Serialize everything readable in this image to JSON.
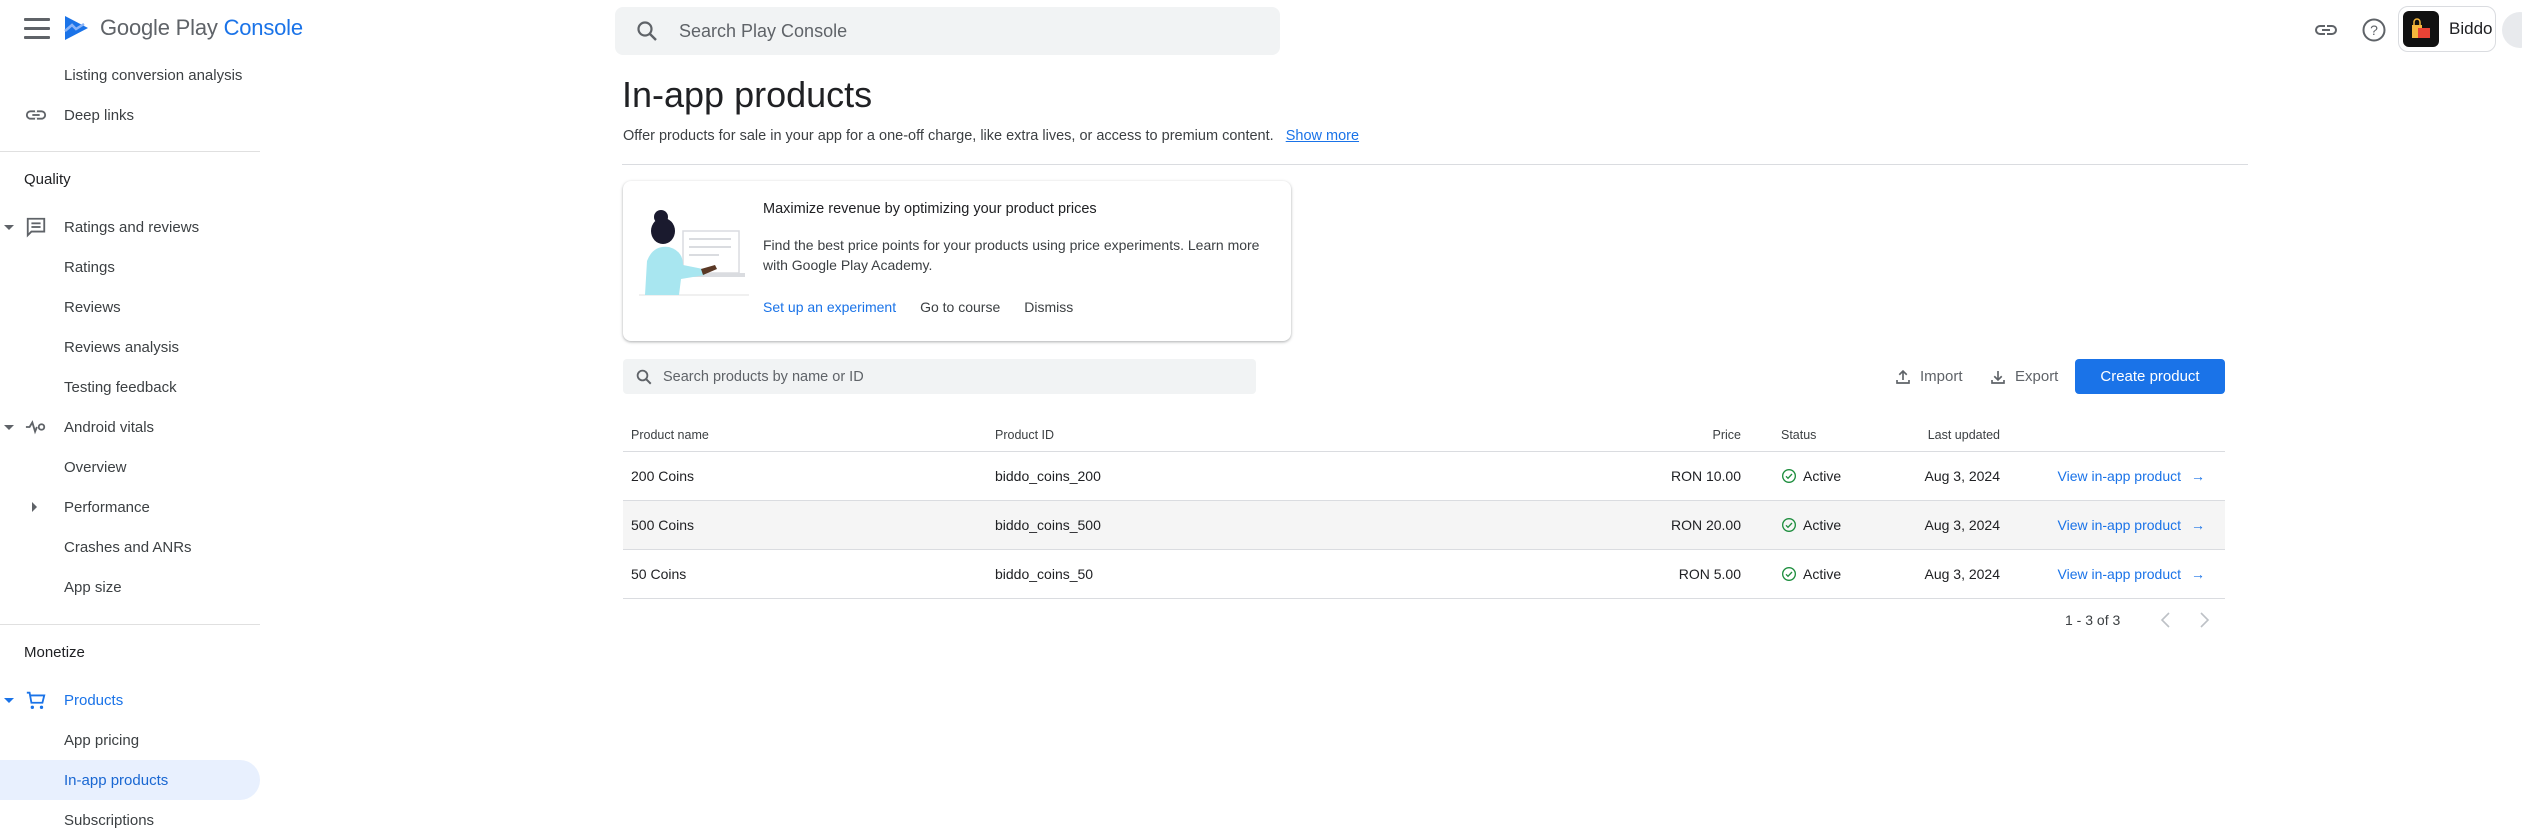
{
  "header": {
    "brand_primary": "Google Play",
    "brand_secondary": "Console",
    "search_placeholder": "Search Play Console",
    "app_name": "Biddo",
    "icons": [
      "menu-icon",
      "play-console-logo",
      "search-icon",
      "link-icon",
      "help-icon",
      "app-icon",
      "account-icon"
    ]
  },
  "sidebar": {
    "items_top": [
      {
        "label": "Listing conversion analysis"
      },
      {
        "label": "Deep links",
        "icon": "link-icon"
      }
    ],
    "section_quality": "Quality",
    "quality_items": [
      {
        "label": "Ratings and reviews",
        "icon": "reviews-icon",
        "expanded": true
      },
      {
        "label": "Ratings"
      },
      {
        "label": "Reviews"
      },
      {
        "label": "Reviews analysis"
      },
      {
        "label": "Testing feedback"
      },
      {
        "label": "Android vitals",
        "icon": "vitals-icon",
        "expanded": true
      },
      {
        "label": "Overview"
      },
      {
        "label": "Performance",
        "collapsed": true
      },
      {
        "label": "Crashes and ANRs"
      },
      {
        "label": "App size"
      }
    ],
    "section_monetize": "Monetize",
    "monetize_items": [
      {
        "label": "Products",
        "icon": "cart-icon",
        "expanded": true,
        "active": true
      },
      {
        "label": "App pricing"
      },
      {
        "label": "In-app products",
        "selected": true
      },
      {
        "label": "Subscriptions"
      }
    ]
  },
  "page": {
    "title": "In-app products",
    "subtitle": "Offer products for sale in your app for a one-off charge, like extra lives, or access to premium content.",
    "show_more": "Show more"
  },
  "promo_card": {
    "title": "Maximize revenue by optimizing your product prices",
    "body": "Find the best price points for your products using price experiments. Learn more with Google Play Academy.",
    "action_primary": "Set up an experiment",
    "action_course": "Go to course",
    "action_dismiss": "Dismiss"
  },
  "toolbar": {
    "search_placeholder": "Search products by name or ID",
    "import_label": "Import",
    "export_label": "Export",
    "create_label": "Create product"
  },
  "table": {
    "columns": [
      "Product name",
      "Product ID",
      "Price",
      "Last updated",
      "Status"
    ],
    "rows": [
      {
        "name": "200 Coins",
        "id": "biddo_coins_200",
        "price": "RON 10.00",
        "updated": "Aug 3, 2024",
        "status": "Active",
        "link": "View in-app product"
      },
      {
        "name": "500 Coins",
        "id": "biddo_coins_500",
        "price": "RON 20.00",
        "updated": "Aug 3, 2024",
        "status": "Active",
        "link": "View in-app product"
      },
      {
        "name": "50 Coins",
        "id": "biddo_coins_50",
        "price": "RON 5.00",
        "updated": "Aug 3, 2024",
        "status": "Active",
        "link": "View in-app product"
      }
    ],
    "pagination": "1 - 3 of 3"
  },
  "colors": {
    "accent": "#1a73e8",
    "active_status": "#1e8e3e",
    "selected_bg": "#e8f0fe"
  }
}
